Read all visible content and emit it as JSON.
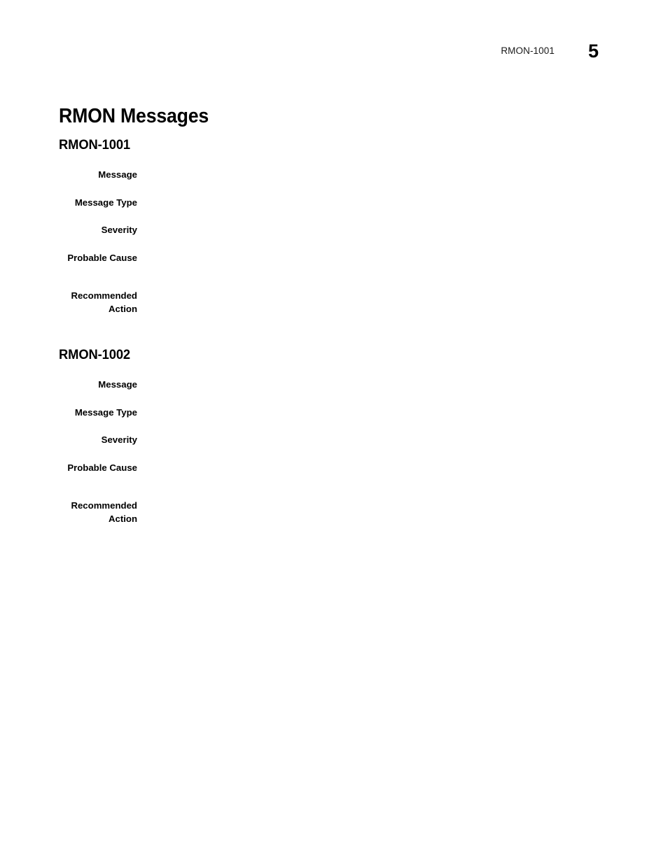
{
  "document": {
    "title": "RMON Messages",
    "header": {
      "running_title": "RMON-1001",
      "page_number": "5"
    }
  },
  "sections": [
    {
      "heading": "RMON-1001",
      "fields": [
        {
          "label": "Message",
          "value": ""
        },
        {
          "label": "Message Type",
          "value": ""
        },
        {
          "label": "Severity",
          "value": ""
        },
        {
          "label": "Probable Cause",
          "value": ""
        },
        {
          "label": "Recommended\nAction",
          "value": ""
        }
      ]
    },
    {
      "heading": "RMON-1002",
      "fields": [
        {
          "label": "Message",
          "value": ""
        },
        {
          "label": "Message Type",
          "value": ""
        },
        {
          "label": "Severity",
          "value": ""
        },
        {
          "label": "Probable Cause",
          "value": ""
        },
        {
          "label": "Recommended\nAction",
          "value": ""
        }
      ]
    }
  ]
}
